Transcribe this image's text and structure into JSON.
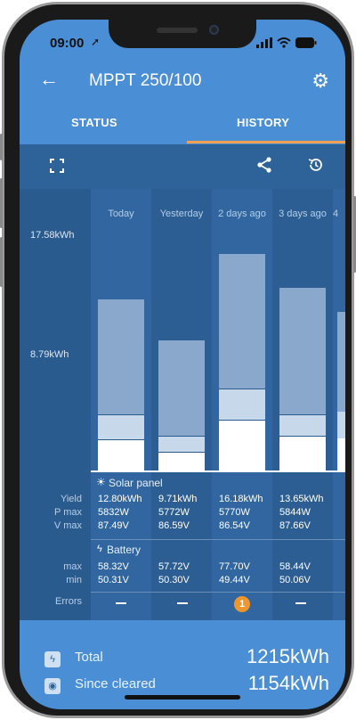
{
  "status_bar": {
    "time": "09:00"
  },
  "header": {
    "title": "MPPT 250/100"
  },
  "tabs": [
    {
      "label": "STATUS"
    },
    {
      "label": "HISTORY"
    }
  ],
  "chart_data": {
    "type": "bar",
    "stacked": true,
    "categories": [
      "Today",
      "Yesterday",
      "2 days ago",
      "3 days ago"
    ],
    "y_tick_labels": [
      "17.58kWh",
      "8.79kWh"
    ],
    "ylim": [
      0,
      17.58
    ],
    "series": [
      {
        "values": [
          2.3,
          1.4,
          3.8,
          2.6
        ]
      },
      {
        "values": [
          1.9,
          1.2,
          2.3,
          1.6
        ]
      },
      {
        "values": [
          8.6,
          7.11,
          10.08,
          9.45
        ]
      }
    ],
    "colors": [
      "#ffffff",
      "#c7d8ea",
      "#89a8cc"
    ]
  },
  "solar": {
    "title": "Solar panel",
    "row_labels": [
      "Yield",
      "P max",
      "V max"
    ],
    "yield": [
      "12.80kWh",
      "9.71kWh",
      "16.18kWh",
      "13.65kWh"
    ],
    "pmax": [
      "5832W",
      "5772W",
      "5770W",
      "5844W"
    ],
    "vmax": [
      "87.49V",
      "86.59V",
      "86.54V",
      "87.66V"
    ]
  },
  "battery": {
    "title": "Battery",
    "row_labels": [
      "max",
      "min"
    ],
    "max": [
      "58.32V",
      "57.72V",
      "77.70V",
      "58.44V"
    ],
    "min": [
      "50.31V",
      "50.30V",
      "49.44V",
      "50.06V"
    ]
  },
  "errors": {
    "label": "Errors",
    "badge": "1"
  },
  "totals": {
    "total_label": "Total",
    "total_value": "1215kWh",
    "cleared_label": "Since cleared",
    "cleared_value": "1154kWh"
  },
  "colors": {
    "accent": "#4a8fd6",
    "tab_indicator": "#f0a050",
    "error_badge": "#f0962e"
  }
}
